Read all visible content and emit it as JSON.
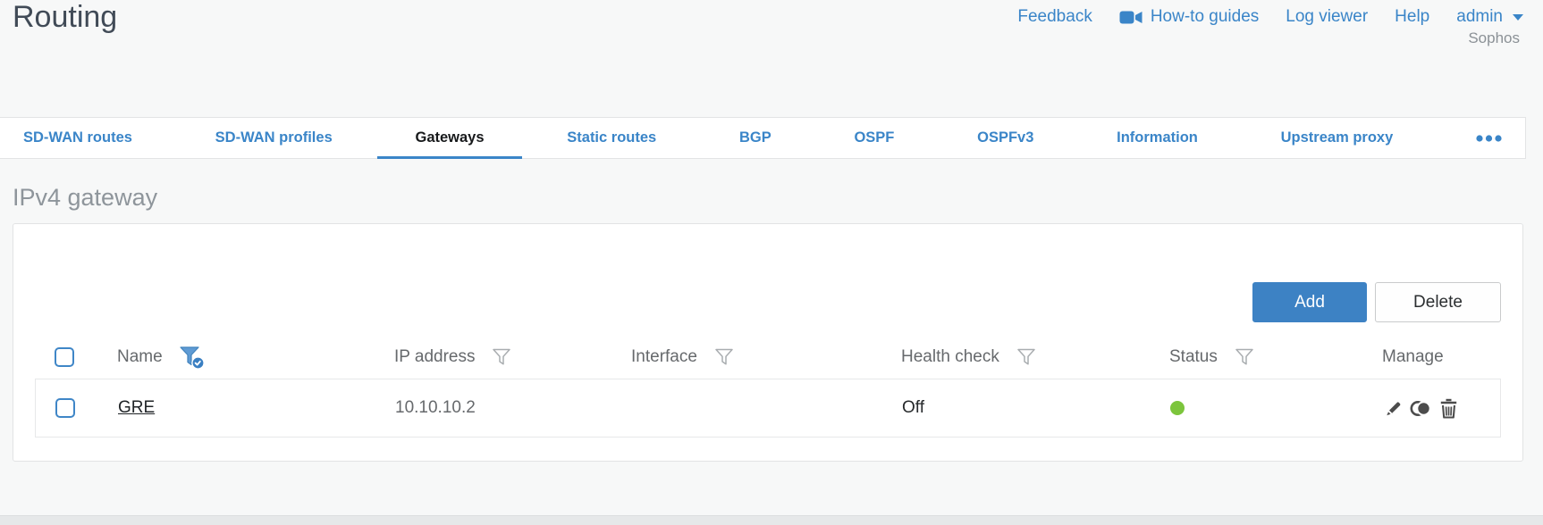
{
  "page": {
    "title": "Routing",
    "brand": "Sophos"
  },
  "topnav": {
    "feedback": "Feedback",
    "howto": "How-to guides",
    "logviewer": "Log viewer",
    "help": "Help",
    "user": "admin"
  },
  "tabs": [
    {
      "label": "SD-WAN routes",
      "active": false
    },
    {
      "label": "SD-WAN profiles",
      "active": false
    },
    {
      "label": "Gateways",
      "active": true
    },
    {
      "label": "Static routes",
      "active": false
    },
    {
      "label": "BGP",
      "active": false
    },
    {
      "label": "OSPF",
      "active": false
    },
    {
      "label": "OSPFv3",
      "active": false
    },
    {
      "label": "Information",
      "active": false
    },
    {
      "label": "Upstream proxy",
      "active": false
    }
  ],
  "section": {
    "heading": "IPv4 gateway"
  },
  "toolbar": {
    "add": "Add",
    "delete": "Delete"
  },
  "table": {
    "columns": [
      "Name",
      "IP address",
      "Interface",
      "Health check",
      "Status",
      "Manage"
    ],
    "name_filter_active": true,
    "rows": [
      {
        "name": "GRE",
        "ip": "10.10.10.2",
        "interface": "",
        "health_check": "Off",
        "status_color": "#7cc53c"
      }
    ]
  },
  "icons": {
    "howto": "video-camera-icon",
    "user_menu": "caret-down-icon",
    "more_tabs": "ellipsis-icon",
    "name_filter": "funnel-check-icon",
    "column_filter": "funnel-icon",
    "manage": [
      "edit-icon",
      "clone-icon",
      "delete-icon"
    ]
  },
  "colors": {
    "accent_blue": "#3a85c8",
    "button_blue": "#3d82c4",
    "status_green": "#7cc53c"
  }
}
